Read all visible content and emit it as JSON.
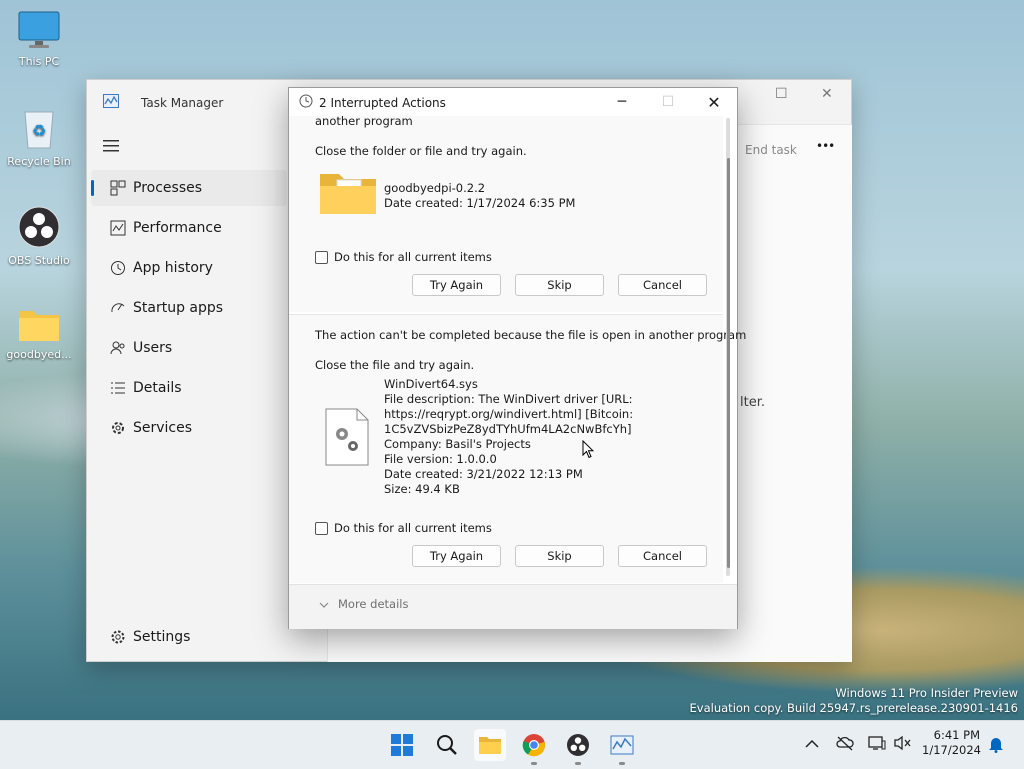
{
  "desktop": {
    "icons": [
      {
        "label": "This PC"
      },
      {
        "label": "Recycle Bin"
      },
      {
        "label": "OBS Studio"
      },
      {
        "label": "goodbyed..."
      }
    ]
  },
  "task_manager": {
    "title": "Task Manager",
    "nav": [
      {
        "label": "Processes",
        "icon": "processes-icon"
      },
      {
        "label": "Performance",
        "icon": "performance-icon"
      },
      {
        "label": "App history",
        "icon": "app-history-icon"
      },
      {
        "label": "Startup apps",
        "icon": "startup-apps-icon"
      },
      {
        "label": "Users",
        "icon": "users-icon"
      },
      {
        "label": "Details",
        "icon": "details-icon"
      },
      {
        "label": "Services",
        "icon": "services-icon"
      }
    ],
    "settings_label": "Settings",
    "end_task_label": "End task",
    "more_label": "•••",
    "partial_text": "lter."
  },
  "dialog": {
    "title": "2 Interrupted Actions",
    "item1": {
      "top_text": "another program",
      "instruction": "Close the folder or file and try again.",
      "name": "goodbyedpi-0.2.2",
      "date": "Date created: 1/17/2024 6:35 PM",
      "checkbox": "Do this for all current items",
      "try_again": "Try Again",
      "skip": "Skip",
      "cancel": "Cancel"
    },
    "item2": {
      "message": "The action can't be completed because the file is open in another program",
      "instruction": "Close the file and try again.",
      "lines": [
        "WinDivert64.sys",
        "File description: The WinDivert driver [URL:",
        "https://reqrypt.org/windivert.html] [Bitcoin:",
        "1C5vZVSbizPeZ8ydTYhUfm4LA2cNwBfcYh]",
        "Company: Basil's Projects",
        "File version: 1.0.0.0",
        "Date created: 3/21/2022 12:13 PM",
        "Size: 49.4 KB"
      ],
      "checkbox": "Do this for all current items",
      "try_again": "Try Again",
      "skip": "Skip",
      "cancel": "Cancel"
    },
    "more_details": "More details"
  },
  "watermark": {
    "line1": "Windows 11 Pro Insider Preview",
    "line2": "Evaluation copy. Build 25947.rs_prerelease.230901-1416"
  },
  "taskbar": {
    "time": "6:41 PM",
    "date": "1/17/2024"
  },
  "colors": {
    "accent": "#0067c0",
    "folder": "#f4c542",
    "taskbar_active": "#c42b1c"
  }
}
